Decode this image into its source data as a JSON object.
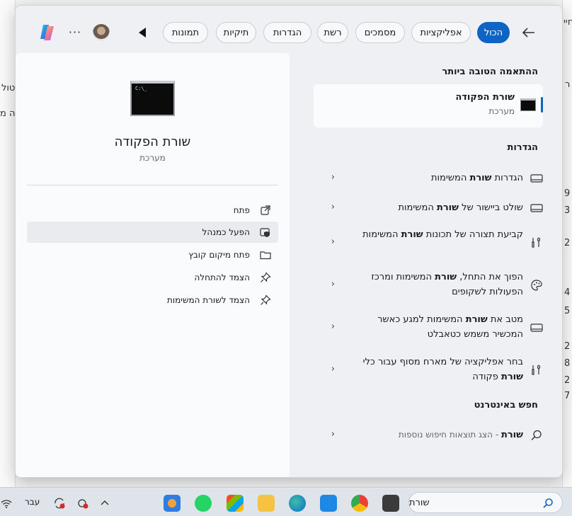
{
  "background_window": {
    "fragments": [
      "חיי",
      "ר",
      "טול",
      "ה מ",
      "9",
      "3",
      "2",
      "4",
      "5",
      "2",
      "8",
      "2",
      "7"
    ]
  },
  "search_panel": {
    "filter_tabs": [
      {
        "label": "הכול",
        "active": true
      },
      {
        "label": "אפליקציות",
        "active": false
      },
      {
        "label": "מסמכים",
        "active": false
      },
      {
        "label": "רשת",
        "active": false
      },
      {
        "label": "הגדרות",
        "active": false
      },
      {
        "label": "תיקיות",
        "active": false
      },
      {
        "label": "תמונות",
        "active": false
      }
    ],
    "more_label": "···"
  },
  "preview": {
    "app_title": "שורת הפקודה",
    "app_subtitle": "מערכת",
    "actions": [
      {
        "label": "פתח",
        "icon": "open-external-icon"
      },
      {
        "label": "הפעל כמנהל",
        "icon": "shield-admin-icon"
      },
      {
        "label": "פתח מיקום קובץ",
        "icon": "folder-icon"
      },
      {
        "label": "הצמד להתחלה",
        "icon": "pin-icon"
      },
      {
        "label": "הצמד לשורת המשימות",
        "icon": "pin-icon"
      }
    ]
  },
  "results": {
    "best_match_heading": "ההתאמה הטובה ביותר",
    "best_match": {
      "title": "שורת הפקודה",
      "subtitle": "מערכת"
    },
    "settings_heading": "הגדרות",
    "settings": [
      {
        "pre": "הגדרות ",
        "bold": "שורת",
        "post": " המשימות",
        "icon": "taskbar-icon"
      },
      {
        "pre": "שולט ביישור של ",
        "bold": "שורת",
        "post": " המשימות",
        "icon": "taskbar-icon"
      },
      {
        "pre": "קביעת תצורה של תכונות ",
        "bold": "שורת",
        "post": " המשימות",
        "icon": "tools-icon"
      },
      {
        "pre": "הפוך את התחל, ",
        "bold": "שורת",
        "post": " המשימות ומרכז הפעולות לשקופים",
        "icon": "palette-icon"
      },
      {
        "pre": "מטב את ",
        "bold": "שורת",
        "post": " המשימות למגע כאשר המכשיר משמש כטאבלט",
        "icon": "taskbar-icon"
      },
      {
        "pre": "בחר אפליקציה של מארח מסוף עבור כלי ",
        "bold": "שורת",
        "post": " פקודה",
        "icon": "tools-icon"
      }
    ],
    "web_heading": "חפש באינטרנט",
    "web_result": {
      "bold": "שורת",
      "sub": " - הצג תוצאות חיפוש נוספות"
    }
  },
  "taskbar": {
    "search_value": "שורת",
    "tray_language": "עבר"
  },
  "colors": {
    "accent": "#0e64c4"
  }
}
